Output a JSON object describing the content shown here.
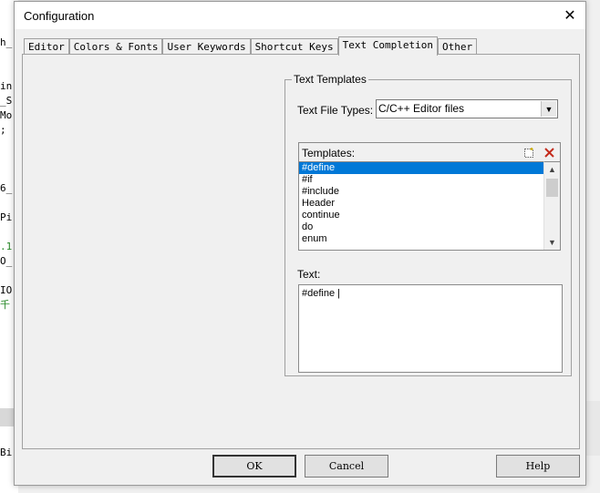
{
  "background": {
    "lines": [
      {
        "text": "h_",
        "color": "#000000"
      },
      {
        "text": "in",
        "color": "#000000"
      },
      {
        "text": "_S",
        "color": "#000000"
      },
      {
        "text": "Mo",
        "color": "#000000"
      },
      {
        "text": ";",
        "color": "#000000"
      },
      {
        "text": "6_",
        "color": "#000000"
      },
      {
        "text": "Pi",
        "color": "#000000"
      },
      {
        "text": ".1",
        "color": "#2a8a2a"
      },
      {
        "text": "O_",
        "color": "#000000"
      },
      {
        "text": "IO",
        "color": "#000000"
      },
      {
        "text": "千",
        "color": "#2a8a2a"
      },
      {
        "text": "Bi",
        "color": "#000000"
      }
    ]
  },
  "dialog": {
    "title": "Configuration",
    "close_glyph": "✕",
    "tabs": [
      {
        "label": "Editor",
        "active": false
      },
      {
        "label": "Colors & Fonts",
        "active": false
      },
      {
        "label": "User Keywords",
        "active": false
      },
      {
        "label": "Shortcut Keys",
        "active": false
      },
      {
        "label": "Text Completion",
        "active": true
      },
      {
        "label": "Other",
        "active": false
      }
    ],
    "group_title": "Text Templates",
    "file_types_label": "Text File Types:",
    "file_types_value": "C/C++ Editor files",
    "templates_label": "Templates:",
    "templates": [
      "#define",
      "#if",
      "#include",
      "Header",
      "continue",
      "do",
      "enum"
    ],
    "selected_template": "#define",
    "text_label": "Text:",
    "text_value": "#define |",
    "buttons": {
      "ok": "OK",
      "cancel": "Cancel",
      "help": "Help"
    }
  },
  "colors": {
    "selection": "#0078d7",
    "delete_icon": "#c42b1c"
  }
}
